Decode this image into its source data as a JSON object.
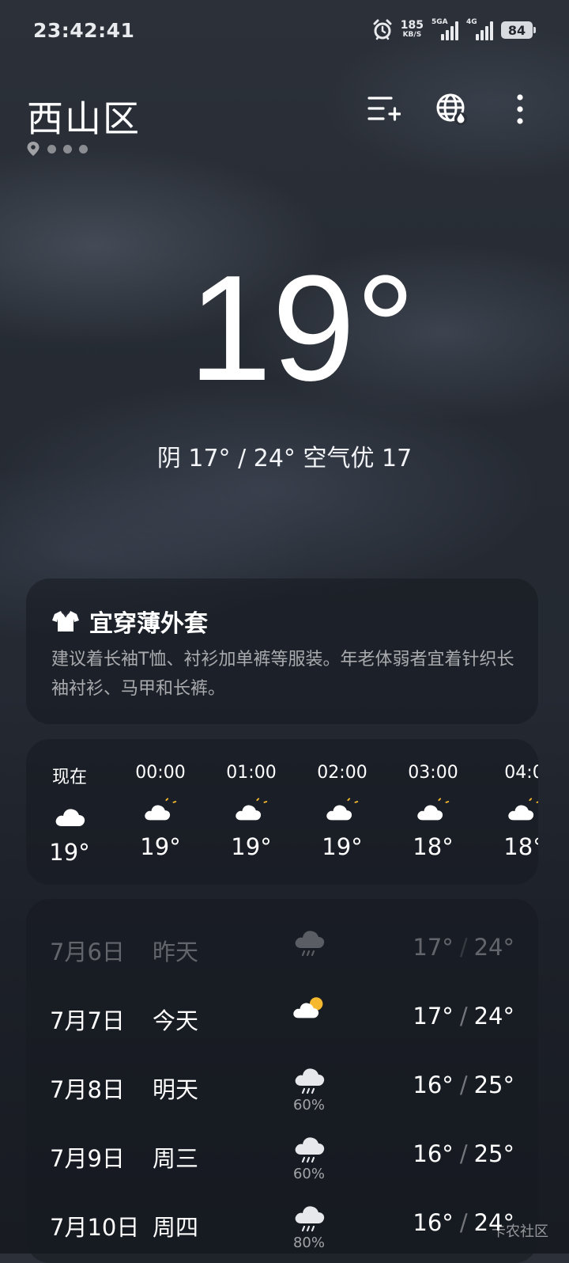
{
  "status_bar": {
    "time": "23:42:41",
    "net_speed": "185",
    "net_speed_unit": "KB/S",
    "network1": "5GA",
    "network2": "4G",
    "battery": "84"
  },
  "header": {
    "city": "西山区",
    "page_dots": 3
  },
  "current": {
    "temperature": "19°",
    "summary": "阴  17° / 24°  空气优 17"
  },
  "advice": {
    "title": "宜穿薄外套",
    "text": "建议着长袖T恤、衬衫加单裤等服装。年老体弱者宜着针织长袖衬衫、马甲和长裤。"
  },
  "hourly": [
    {
      "time": "现在",
      "icon": "cloud-icon",
      "temp": "19°"
    },
    {
      "time": "00:00",
      "icon": "cloud-moon-icon",
      "temp": "19°"
    },
    {
      "time": "01:00",
      "icon": "cloud-moon-icon",
      "temp": "19°"
    },
    {
      "time": "02:00",
      "icon": "cloud-moon-icon",
      "temp": "19°"
    },
    {
      "time": "03:00",
      "icon": "cloud-moon-icon",
      "temp": "18°"
    },
    {
      "time": "04:0",
      "icon": "cloud-moon-icon",
      "temp": "18°"
    }
  ],
  "daily": [
    {
      "date": "7月6日",
      "name": "昨天",
      "icon": "rain-icon",
      "pct": "",
      "low": "17°",
      "high": "24°",
      "past": true
    },
    {
      "date": "7月7日",
      "name": "今天",
      "icon": "cloud-sun-icon",
      "pct": "",
      "low": "17°",
      "high": "24°",
      "past": false
    },
    {
      "date": "7月8日",
      "name": "明天",
      "icon": "rain-icon",
      "pct": "60%",
      "low": "16°",
      "high": "25°",
      "past": false
    },
    {
      "date": "7月9日",
      "name": "周三",
      "icon": "rain-icon",
      "pct": "60%",
      "low": "16°",
      "high": "25°",
      "past": false
    },
    {
      "date": "7月10日",
      "name": "周四",
      "icon": "rain-icon",
      "pct": "80%",
      "low": "16°",
      "high": "24°",
      "past": false
    }
  ],
  "watermark": "卡农社区",
  "colors": {
    "sun": "#f5b82e",
    "cloud": "#ffffff",
    "rain_cloud": "#e6e8ec"
  }
}
